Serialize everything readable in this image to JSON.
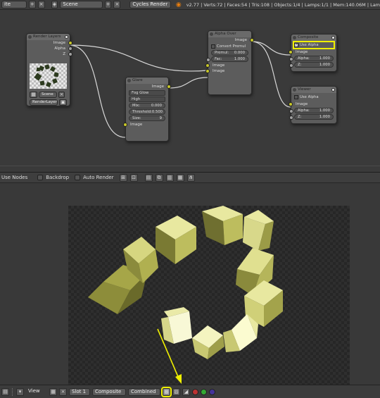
{
  "top_header": {
    "editor_label": "ite",
    "scene_name": "Scene",
    "render_engine": "Cycles Render",
    "stats": "v2.77 | Verts:72 | Faces:54 | Tris:108 | Objects:1/4 | Lamps:1/1 | Mem:140.06M | Lam"
  },
  "nodes": {
    "render_layers": {
      "title": "Render Layers",
      "outputs": [
        "Image",
        "Alpha",
        "Z"
      ],
      "scene_label": "Scene",
      "layer": "RenderLayer"
    },
    "glare": {
      "title": "Glare",
      "output": "Image",
      "glare_type": "Fog Glow",
      "quality": "High",
      "fields": [
        {
          "label": "Mix:",
          "value": "0.000"
        },
        {
          "label": "Threshold:",
          "value": "0.500"
        },
        {
          "label": "Size:",
          "value": "9"
        }
      ],
      "input": "Image"
    },
    "alpha_over": {
      "title": "Alpha Over",
      "output": "Image",
      "convert_premul": "Convert Premul",
      "fields": [
        {
          "label": "Premul:",
          "value": "0.000"
        },
        {
          "label": "Fac:",
          "value": "1.000"
        }
      ],
      "inputs": [
        "Image",
        "Image"
      ]
    },
    "composite": {
      "title": "Composite",
      "use_alpha": "Use Alpha",
      "input": "Image",
      "fields": [
        {
          "label": "Alpha:",
          "value": "1.000"
        },
        {
          "label": "Z:",
          "value": "1.000"
        }
      ]
    },
    "viewer": {
      "title": "Viewer",
      "use_alpha": "Use Alpha",
      "input": "Image",
      "fields": [
        {
          "label": "Alpha:",
          "value": "1.000"
        },
        {
          "label": "Z:",
          "value": "1.000"
        }
      ]
    }
  },
  "view_header": {
    "use_nodes": "Use Nodes",
    "backdrop": "Backdrop",
    "auto_render": "Auto Render"
  },
  "bottom_header": {
    "view": "View",
    "slot": "Slot 1",
    "composite": "Composite",
    "combined": "Combined"
  },
  "colors": {
    "highlight": "#f0f000",
    "socket_color": "#c7c729",
    "socket_value": "#a1a1a1",
    "cube_face_light": "#e8e8a0",
    "cube_face_mid": "#bdbd5e",
    "cube_face_dark": "#7a7a33"
  },
  "icons": [
    "x-icon",
    "blender-logo-icon",
    "node-tree-icon",
    "grid-icon",
    "checker-alpha-icon"
  ]
}
